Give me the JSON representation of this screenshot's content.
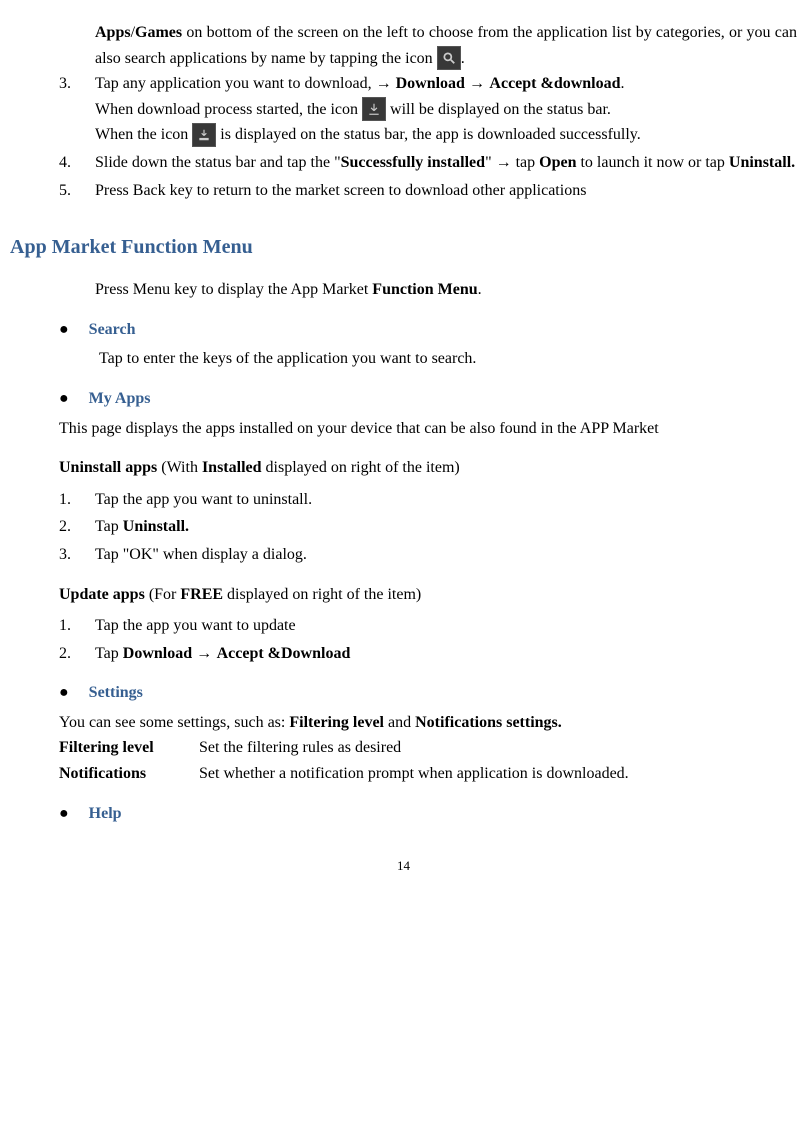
{
  "intro": {
    "line1_a": "Apps",
    "line1_slash": "/",
    "line1_b": "Games",
    "line1_rest": " on bottom of the screen on the left to choose from the application list by categories, or you can also search applications by name by tapping the icon ",
    "line1_period": "."
  },
  "step3": {
    "num": "3.",
    "text_a": "Tap  any  application  you  want  to  download,  ",
    "arrow1": "→",
    "bold_b": "  Download ",
    "arrow2": " → ",
    "bold_c": "  Accept &download",
    "period": ".",
    "line2_a": "When download process started, the icon ",
    "line2_b": " will be displayed on the status bar.",
    "line3_a": "When  the  icon  ",
    "line3_b": "  is  displayed  on  the  status  bar,  the  app  is  downloaded successfully."
  },
  "step4": {
    "num": "4.",
    "text_a": "Slide down the status bar and tap the \"",
    "bold_a": "Successfully installed",
    "text_b": "\"  ",
    "arrow": "→",
    "text_c": "  tap ",
    "bold_b": "Open",
    "text_d": " to launch it now or tap ",
    "bold_c": "Uninstall."
  },
  "step5": {
    "num": "5.",
    "text": "Press Back key to return to the market screen to download other applications"
  },
  "section_title": "App Market Function Menu",
  "section_intro_a": "Press Menu key to display the App Market ",
  "section_intro_b": "Function Menu",
  "section_intro_c": ".",
  "search": {
    "title": "Search",
    "desc": "Tap to enter the keys of the application you want to search."
  },
  "myapps": {
    "title": "My Apps",
    "desc": "This page displays the apps installed on your device that can be also found in the APP Market",
    "uninstall_label_a": "Uninstall apps",
    "uninstall_label_b": " (With ",
    "uninstall_label_c": "Installed",
    "uninstall_label_d": " displayed on right of the item)",
    "u1_num": "1.",
    "u1": "Tap the app you want to uninstall.",
    "u2_num": "2.",
    "u2_a": "Tap ",
    "u2_b": "Uninstall.",
    "u3_num": "3.",
    "u3": "Tap \"OK\" when display a dialog.",
    "update_label_a": "Update apps",
    "update_label_b": " (For ",
    "update_label_c": "FREE",
    "update_label_d": " displayed on right of the item)",
    "up1_num": "1.",
    "up1": "Tap the app you want to update",
    "up2_num": "2.",
    "up2_a": "Tap ",
    "up2_b": "Download ",
    "up2_arrow": " → ",
    "up2_c": " Accept &Download"
  },
  "settings": {
    "title": "Settings",
    "desc_a": "You can see some settings, such as: ",
    "desc_b": "Filtering level",
    "desc_c": " and ",
    "desc_d": "Notifications settings.",
    "row1_label": "Filtering level",
    "row1_val": "Set the filtering rules as desired",
    "row2_label": "Notifications",
    "row2_val": "Set whether a notification prompt when application is downloaded."
  },
  "help": {
    "title": "Help"
  },
  "page_num": "14"
}
